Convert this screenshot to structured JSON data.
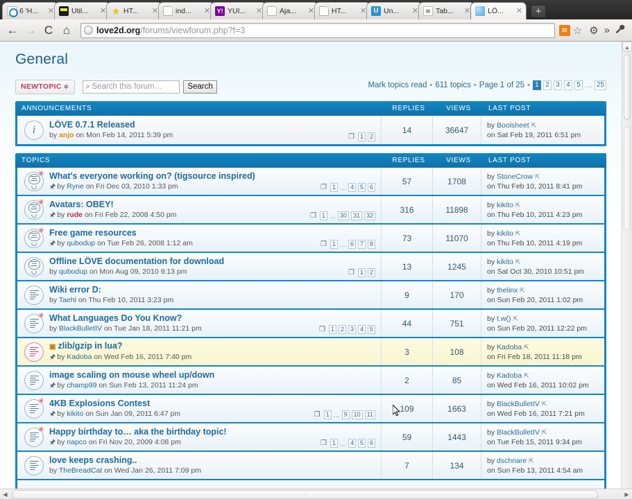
{
  "browser": {
    "tabs": [
      {
        "title": "6 'H...",
        "favicon": "fav-blue-circle",
        "glyph": "",
        "active": false
      },
      {
        "title": "Util...",
        "favicon": "fav-dark",
        "glyph": "",
        "active": false
      },
      {
        "title": "HT...",
        "favicon": "fav-star",
        "glyph": "★",
        "active": false
      },
      {
        "title": "ind...",
        "favicon": "fav-doc",
        "glyph": "",
        "active": false
      },
      {
        "title": "YUI...",
        "favicon": "fav-yahoo",
        "glyph": "Y!",
        "active": false
      },
      {
        "title": "Aja...",
        "favicon": "fav-doc",
        "glyph": "",
        "active": false
      },
      {
        "title": "HT...",
        "favicon": "fav-doc",
        "glyph": "",
        "active": false
      },
      {
        "title": "Un...",
        "favicon": "fav-u",
        "glyph": "U",
        "active": false
      },
      {
        "title": "Tab...",
        "favicon": "fav-tab",
        "glyph": "≋",
        "active": false
      },
      {
        "title": "LÖ...",
        "favicon": "fav-globe",
        "glyph": "",
        "active": true
      }
    ],
    "tab_close_glyph": "✕",
    "new_tab_label": "+",
    "nav": {
      "back": "←",
      "forward": "→",
      "reload": "C",
      "home": "⌂",
      "url_domain": "love2d.org",
      "url_path": "/forums/viewforum.php?f=3",
      "rss": "≋",
      "bookmark_star": "☆",
      "gear": "⚙",
      "chevrons": "»",
      "wrench": "🔧"
    }
  },
  "page": {
    "forum_title": "General",
    "new_topic_label": "NEWTOPIC",
    "new_topic_star": "✶",
    "search_placeholder": "Search this forum…",
    "search_button": "Search",
    "search_icon": "⌕",
    "meta": {
      "mark_read": "Mark topics read",
      "sep": "•",
      "topics_count": "611 topics",
      "page_of": "Page 1 of 25",
      "pages": [
        "1",
        "2",
        "3",
        "4",
        "5"
      ],
      "ellipsis": "…",
      "last_page": "25",
      "current_page": "1"
    },
    "columns": {
      "replies": "REPLIES",
      "views": "VIEWS",
      "last_post": "LAST POST"
    },
    "announcements": {
      "header": "ANNOUNCEMENTS",
      "rows": [
        {
          "icon": "info",
          "title": "LÖVE 0.7.1 Released",
          "by_prefix": "by",
          "author": "anjo",
          "author_style": "orange",
          "date": "on Mon Feb 14, 2011 5:39 pm",
          "attachment": false,
          "newmark": false,
          "minipages": [
            "1",
            "2"
          ],
          "mini_ellipsis": false,
          "replies": "14",
          "views": "36647",
          "last_by": "by",
          "last_user": "Boolsheet",
          "last_date": "on Sat Feb 19, 2011 6:51 pm"
        }
      ]
    },
    "topics": {
      "header": "TOPICS",
      "rows": [
        {
          "icon": "bulb-star",
          "title": "What's everyone working on? (tigsource inspired)",
          "by_prefix": "by",
          "author": "Ryne",
          "author_style": "normal",
          "date": "on Fri Dec 03, 2010 1:33 pm",
          "attachment": true,
          "newmark": false,
          "minipages": [
            "1",
            "…",
            "4",
            "5",
            "6"
          ],
          "replies": "57",
          "views": "1708",
          "last_by": "by",
          "last_user": "StoneCrow",
          "last_date": "on Thu Feb 10, 2011 8:41 pm",
          "highlight": false
        },
        {
          "icon": "bulb-star",
          "title": "Avatars: OBEY!",
          "by_prefix": "by",
          "author": "rude",
          "author_style": "red",
          "date": "on Fri Feb 22, 2008 4:50 pm",
          "attachment": true,
          "newmark": false,
          "minipages": [
            "1",
            "…",
            "30",
            "31",
            "32"
          ],
          "replies": "316",
          "views": "11898",
          "last_by": "by",
          "last_user": "kikito",
          "last_date": "on Thu Feb 10, 2011 4:23 pm",
          "highlight": false
        },
        {
          "icon": "bulb-star",
          "title": "Free game resources",
          "by_prefix": "by",
          "author": "qubodup",
          "author_style": "normal",
          "date": "on Tue Feb 26, 2008 1:12 am",
          "attachment": true,
          "newmark": false,
          "minipages": [
            "1",
            "…",
            "6",
            "7",
            "8"
          ],
          "replies": "73",
          "views": "11070",
          "last_by": "by",
          "last_user": "kikito",
          "last_date": "on Thu Feb 10, 2011 4:19 pm",
          "highlight": false
        },
        {
          "icon": "bulb",
          "title": "Offline LÖVE documentation for download",
          "by_prefix": "by",
          "author": "qubodup",
          "author_style": "normal",
          "date": "on Mon Aug 09, 2010 9:13 pm",
          "attachment": false,
          "newmark": false,
          "minipages": [
            "1",
            "2"
          ],
          "replies": "13",
          "views": "1245",
          "last_by": "by",
          "last_user": "kikito",
          "last_date": "on Sat Oct 30, 2010 10:51 pm",
          "highlight": false
        },
        {
          "icon": "doc",
          "title": "Wiki error D:",
          "by_prefix": "by",
          "author": "Taehl",
          "author_style": "normal",
          "date": "on Thu Feb 10, 2011 3:23 pm",
          "attachment": false,
          "newmark": false,
          "minipages": [],
          "replies": "9",
          "views": "170",
          "last_by": "by",
          "last_user": "thelinx",
          "last_date": "on Sun Feb 20, 2011 1:02 pm",
          "highlight": false
        },
        {
          "icon": "doc-star",
          "title": "What Languages Do You Know?",
          "by_prefix": "by",
          "author": "BlackBulletIV",
          "author_style": "normal",
          "date": "on Tue Jan 18, 2011 11:21 pm",
          "attachment": false,
          "newmark": false,
          "minipages": [
            "1",
            "2",
            "3",
            "4",
            "5"
          ],
          "replies": "44",
          "views": "751",
          "last_by": "by",
          "last_user": "t.w()",
          "last_date": "on Sun Feb 20, 2011 12:22 pm",
          "highlight": false
        },
        {
          "icon": "doc-pink",
          "title": "zlib/gzip in lua?",
          "by_prefix": "by",
          "author": "Kadoba",
          "author_style": "normal",
          "date": "on Wed Feb 16, 2011 7:40 pm",
          "attachment": true,
          "newmark": true,
          "minipages": [],
          "replies": "3",
          "views": "108",
          "last_by": "by",
          "last_user": "Kadoba",
          "last_date": "on Fri Feb 18, 2011 11:18 pm",
          "highlight": true
        },
        {
          "icon": "doc",
          "title": "image scaling on mouse wheel up/down",
          "by_prefix": "by",
          "author": "champ99",
          "author_style": "normal",
          "date": "on Sun Feb 13, 2011 11:24 pm",
          "attachment": true,
          "newmark": false,
          "minipages": [],
          "replies": "2",
          "views": "85",
          "last_by": "by",
          "last_user": "Kadoba",
          "last_date": "on Wed Feb 16, 2011 10:02 pm",
          "highlight": false
        },
        {
          "icon": "doc-star",
          "title": "4KB Explosions Contest",
          "by_prefix": "by",
          "author": "kikito",
          "author_style": "normal",
          "date": "on Sun Jan 09, 2011 6:47 pm",
          "attachment": true,
          "newmark": false,
          "minipages": [
            "1",
            "…",
            "9",
            "10",
            "11"
          ],
          "replies": "109",
          "views": "1663",
          "last_by": "by",
          "last_user": "BlackBulletIV",
          "last_date": "on Wed Feb 16, 2011 7:21 pm",
          "highlight": false
        },
        {
          "icon": "doc-star",
          "title": "Happy birthday to… aka the birthday topic!",
          "by_prefix": "by",
          "author": "napco",
          "author_style": "normal",
          "date": "on Fri Nov 20, 2009 4:08 pm",
          "attachment": true,
          "newmark": false,
          "minipages": [
            "1",
            "…",
            "4",
            "5",
            "6"
          ],
          "replies": "59",
          "views": "1443",
          "last_by": "by",
          "last_user": "BlackBulletIV",
          "last_date": "on Tue Feb 15, 2011 9:34 pm",
          "highlight": false
        },
        {
          "icon": "doc",
          "title": "love keeps crashing..",
          "by_prefix": "by",
          "author": "TheBreadCat",
          "author_style": "normal",
          "date": "on Wed Jan 26, 2011 7:09 pm",
          "attachment": false,
          "newmark": false,
          "minipages": [],
          "replies": "7",
          "views": "134",
          "last_by": "by",
          "last_user": "dschnare",
          "last_date": "on Sun Feb 13, 2011 4:54 am",
          "highlight": false
        }
      ]
    },
    "attachment_glyph": "📎",
    "jump_glyph": "⇱",
    "mini_page_glyph": "❐"
  },
  "scroll": {
    "up_arrow": "▲",
    "down_arrow": "▼",
    "left_arrow": "◀",
    "right_arrow": "▶",
    "grip": "⋯"
  }
}
